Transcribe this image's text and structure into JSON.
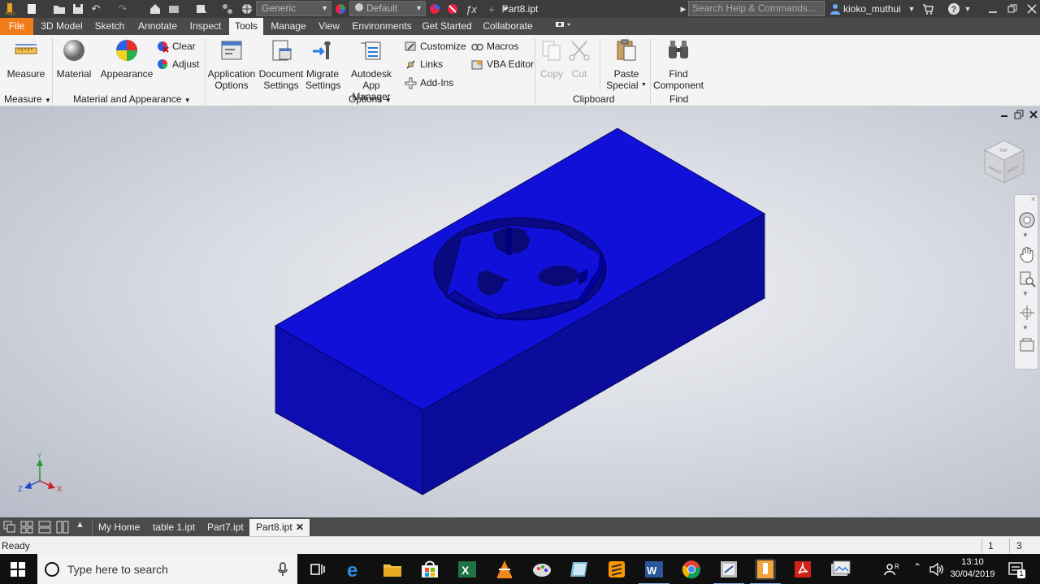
{
  "title_bar": {
    "doc_title": "Part8.ipt",
    "material_combo": "Generic",
    "appearance_combo": "Default",
    "search_placeholder": "Search Help & Commands...",
    "user_name": "kioko_muthui"
  },
  "tabs": [
    "File",
    "3D Model",
    "Sketch",
    "Annotate",
    "Inspect",
    "Tools",
    "Manage",
    "View",
    "Environments",
    "Get Started",
    "Collaborate"
  ],
  "active_tab": "Tools",
  "ribbon": {
    "measure": {
      "label": "Measure",
      "panel": "Measure"
    },
    "material_appearance": {
      "material": "Material",
      "appearance": "Appearance",
      "clear": "Clear",
      "adjust": "Adjust",
      "panel": "Material and Appearance"
    },
    "options": {
      "app_options": [
        "Application",
        "Options"
      ],
      "doc_settings": [
        "Document",
        "Settings"
      ],
      "migrate": [
        "Migrate",
        "Settings"
      ],
      "app_manager": [
        "Autodesk",
        "App Manager"
      ],
      "customize": "Customize",
      "links": "Links",
      "add_ins": "Add-Ins",
      "macros": "Macros",
      "vba": "VBA Editor",
      "panel": "Options"
    },
    "clipboard": {
      "copy": "Copy",
      "cut": "Cut",
      "paste_special": [
        "Paste",
        "Special"
      ],
      "panel": "Clipboard"
    },
    "find": {
      "find_component": [
        "Find",
        "Component"
      ],
      "panel": "Find"
    }
  },
  "viewcube": {
    "top": "TOP",
    "front": "FRONT",
    "right": "RIGHT"
  },
  "axis_labels": {
    "x": "X",
    "y": "Y",
    "z": "Z"
  },
  "model_color": "#1010d8",
  "doc_tabs": [
    "My Home",
    "table 1.ipt",
    "Part7.ipt",
    "Part8.ipt"
  ],
  "active_doc": "Part8.ipt",
  "status": {
    "text": "Ready",
    "num1": "1",
    "num2": "3"
  },
  "taskbar": {
    "search": "Type here to search",
    "time": "13:10",
    "date": "30/04/2019",
    "notifications": "1"
  }
}
